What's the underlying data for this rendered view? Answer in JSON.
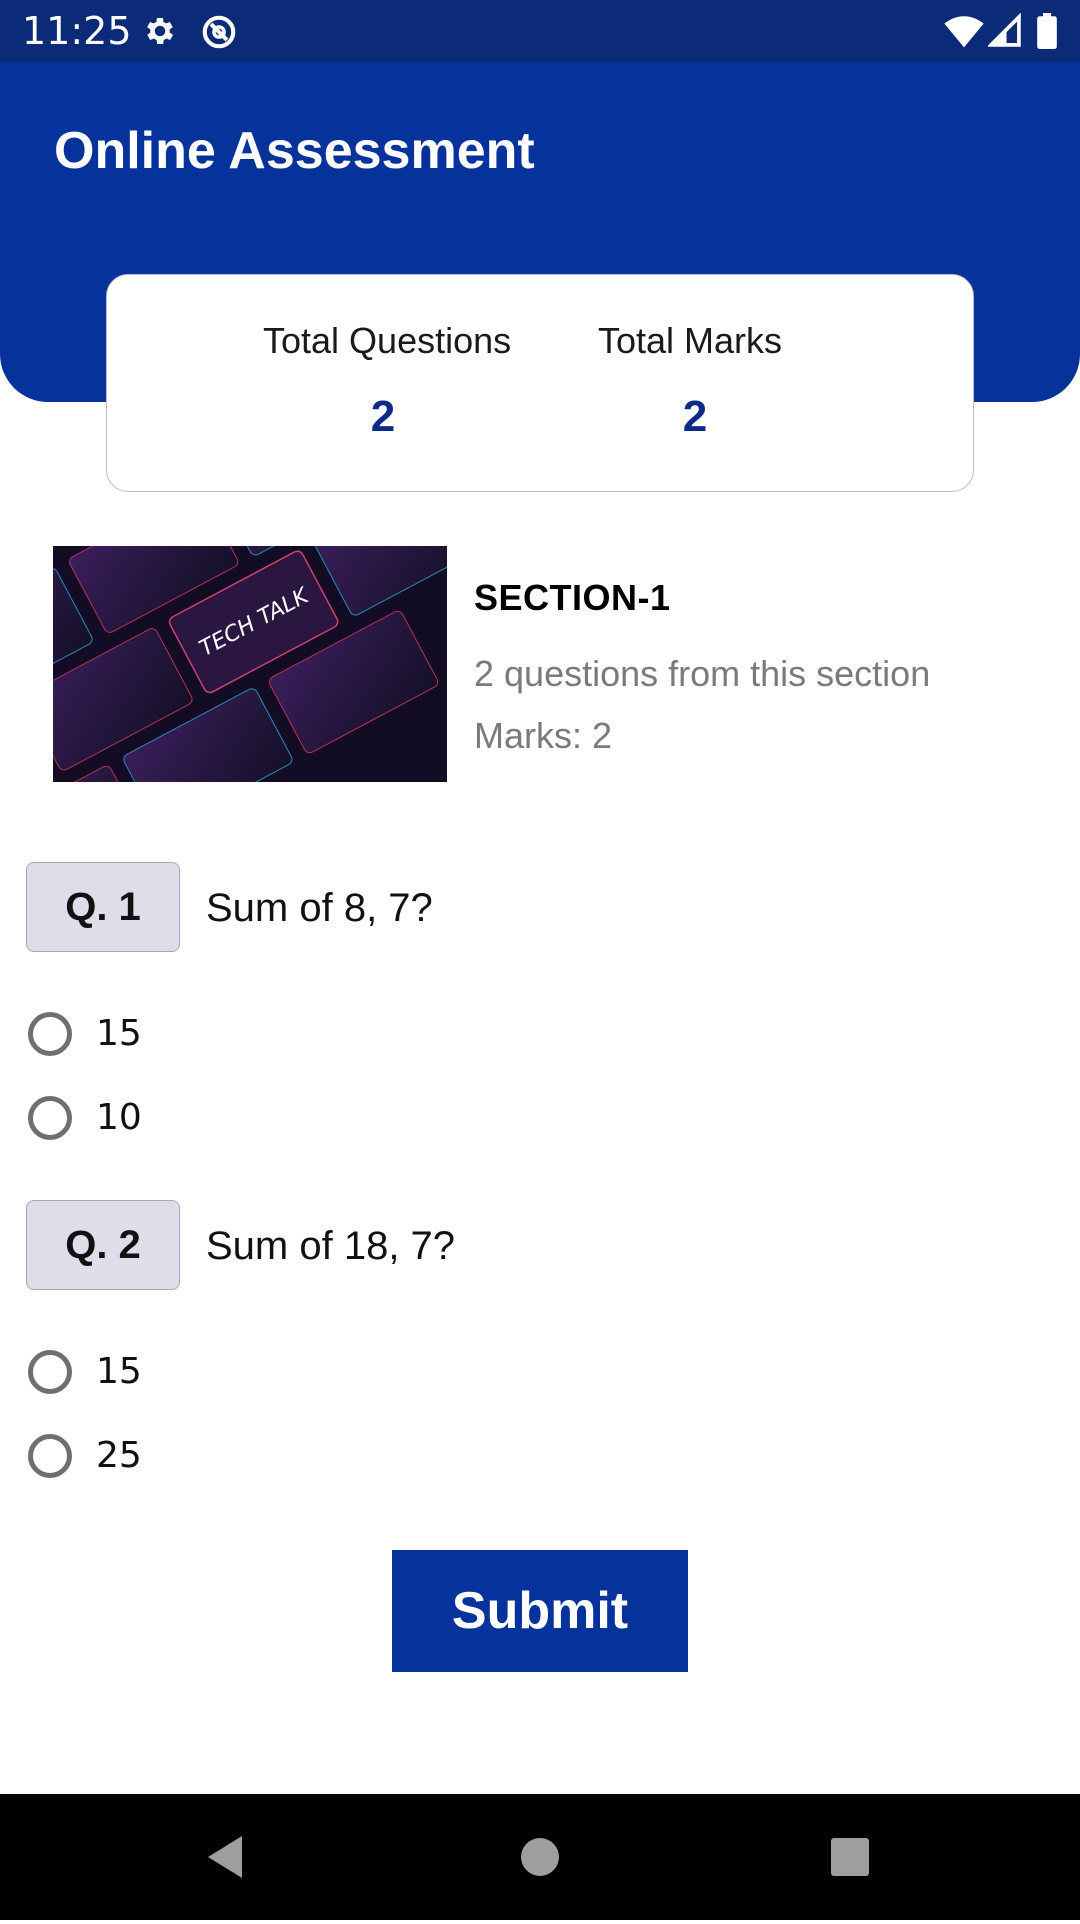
{
  "status_bar": {
    "time": "11:25",
    "icons": [
      "gear-icon",
      "no-disturb-icon",
      "wifi-icon",
      "signal-icon",
      "battery-icon"
    ]
  },
  "header": {
    "title": "Online Assessment"
  },
  "summary": {
    "total_questions_label": "Total Questions",
    "total_questions_value": "2",
    "total_marks_label": "Total Marks",
    "total_marks_value": "2"
  },
  "section": {
    "title": "SECTION-1",
    "description": "2 questions from this section",
    "marks": "Marks: 2",
    "thumbnail_text": "TECH TALK"
  },
  "questions": [
    {
      "badge": "Q. 1",
      "text": "Sum of 8, 7?",
      "options": [
        "15",
        "10"
      ]
    },
    {
      "badge": "Q. 2",
      "text": "Sum of 18, 7?",
      "options": [
        "15",
        "25"
      ]
    }
  ],
  "submit_label": "Submit",
  "colors": {
    "primary": "#06329c",
    "status_bar": "#0b2a78",
    "badge_bg": "#e0dcea",
    "stat_value": "#0b2a8a"
  },
  "nav_bar": {
    "icons": [
      "back-icon",
      "home-icon",
      "recents-icon"
    ]
  }
}
